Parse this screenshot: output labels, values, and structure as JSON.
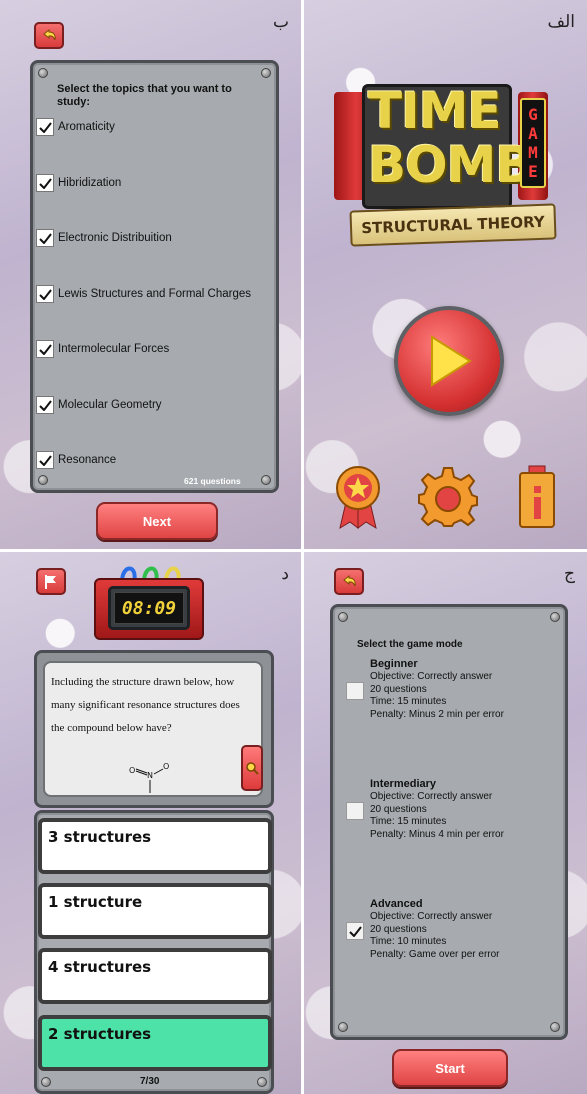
{
  "panels": {
    "a": {
      "label": "الف",
      "logo_line1": "TIME",
      "logo_line2": "BOMB",
      "logo_side": "GAME",
      "banner": "STRUCTURAL THEORY",
      "icons": [
        "play-icon",
        "award-icon",
        "gear-icon",
        "info-battery-icon"
      ]
    },
    "b": {
      "label": "ب",
      "heading": "Select the topics that you want to study:",
      "topics": [
        {
          "label": "Aromaticity",
          "checked": true
        },
        {
          "label": "Hibridization",
          "checked": true
        },
        {
          "label": "Electronic Distribuition",
          "checked": true
        },
        {
          "label": "Lewis Structures and Formal Charges",
          "checked": true
        },
        {
          "label": "Intermolecular Forces",
          "checked": true
        },
        {
          "label": "Molecular Geometry",
          "checked": true
        },
        {
          "label": "Resonance",
          "checked": true
        }
      ],
      "count": "621 questions",
      "next_label": "Next"
    },
    "c": {
      "label": "ج",
      "heading": "Select the game mode",
      "modes": [
        {
          "title": "Beginner",
          "lines": [
            "Objective: Correctly answer",
            "20 questions",
            "Time: 15 minutes",
            "Penalty: Minus 2 min per error"
          ],
          "checked": false
        },
        {
          "title": "Intermediary",
          "lines": [
            "Objective: Correctly answer",
            "20 questions",
            "Time: 15 minutes",
            "Penalty: Minus 4 min per error"
          ],
          "checked": false
        },
        {
          "title": "Advanced",
          "lines": [
            "Objective: Correctly answer",
            "20 questions",
            "Time: 10 minutes",
            "Penalty: Game over per error"
          ],
          "checked": true
        }
      ],
      "start_label": "Start"
    },
    "d": {
      "label": "د",
      "timer": "08:09",
      "question": "Including the structure drawn below, how many significant resonance structures does the compound below have?",
      "answers": [
        {
          "label": "3 structures",
          "correct": false
        },
        {
          "label": "1 structure",
          "correct": false
        },
        {
          "label": "4 structures",
          "correct": false
        },
        {
          "label": "2 structures",
          "correct": true
        }
      ],
      "progress": "7/30"
    }
  },
  "colors": {
    "accent_red": "#e04444",
    "correct_green": "#4de3a8",
    "panel_gray": "#a7abaf"
  }
}
